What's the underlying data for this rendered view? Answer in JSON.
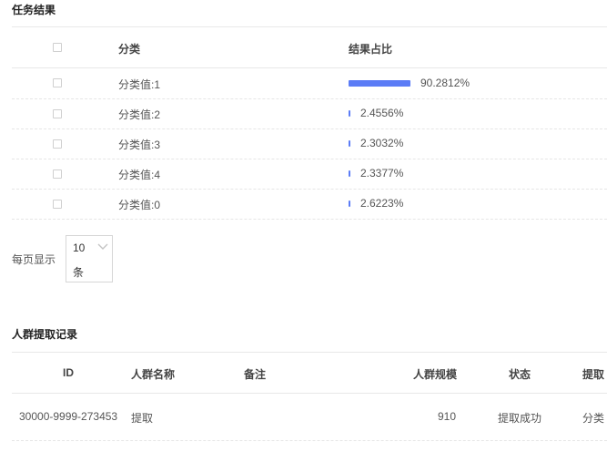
{
  "task_result": {
    "title": "任务结果",
    "columns": {
      "category": "分类",
      "ratio": "结果占比"
    },
    "rows": [
      {
        "category": "分类值:1",
        "percent_label": "90.2812%",
        "fraction": 0.902812
      },
      {
        "category": "分类值:2",
        "percent_label": "2.4556%",
        "fraction": 0.024556
      },
      {
        "category": "分类值:3",
        "percent_label": "2.3032%",
        "fraction": 0.023032
      },
      {
        "category": "分类值:4",
        "percent_label": "2.3377%",
        "fraction": 0.023377
      },
      {
        "category": "分类值:0",
        "percent_label": "2.6223%",
        "fraction": 0.026223
      }
    ],
    "bar_color": "#5b7cf6"
  },
  "pagination": {
    "label": "每页显示",
    "selected_value": "10",
    "unit": "条"
  },
  "extraction_records": {
    "title": "人群提取记录",
    "columns": {
      "id": "ID",
      "name": "人群名称",
      "note": "备注",
      "size": "人群规模",
      "status": "状态",
      "extract": "提取"
    },
    "rows": [
      {
        "id": "30000-9999-273453",
        "name": "提取",
        "note": "",
        "size": "910",
        "status": "提取成功",
        "extract": "分类"
      }
    ]
  },
  "icons": {
    "dropdown": "chevron-down-icon"
  }
}
